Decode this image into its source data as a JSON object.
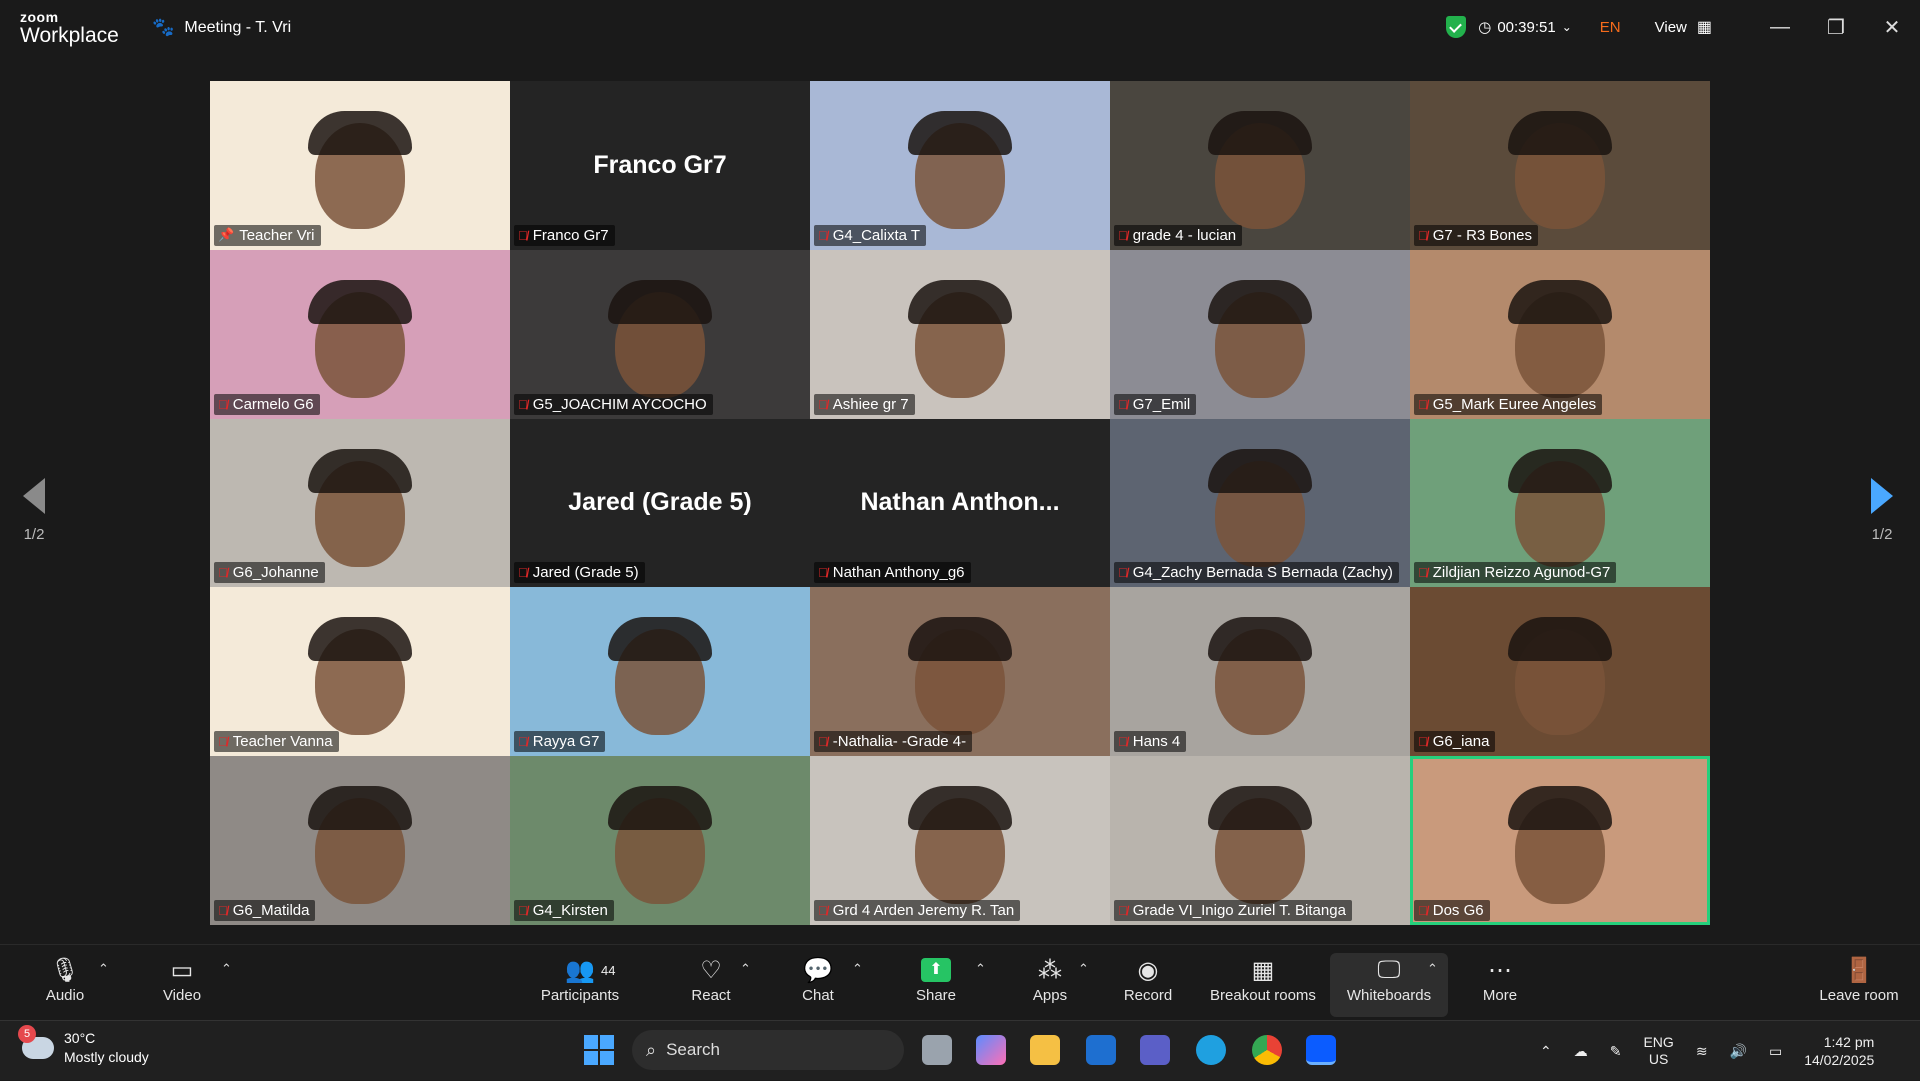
{
  "app": {
    "brand_top": "zoom",
    "brand_bottom": "Workplace",
    "meeting_title": "Meeting - T. Vri"
  },
  "titlebar": {
    "timer": "00:39:51",
    "language": "EN",
    "view_label": "View"
  },
  "pagination": {
    "left": "1/2",
    "right": "1/2"
  },
  "participants": [
    {
      "name": "Teacher Vri",
      "pinned": true,
      "big": "",
      "bg": "#f4ead9"
    },
    {
      "name": "Franco Gr7",
      "pinned": false,
      "big": "Franco Gr7",
      "bg": "#242424"
    },
    {
      "name": "G4_Calixta T",
      "pinned": false,
      "big": "",
      "bg": "#a9b8d6"
    },
    {
      "name": "grade 4 - lucian",
      "pinned": false,
      "big": "",
      "bg": "#4a463f"
    },
    {
      "name": "G7 - R3 Bones",
      "pinned": false,
      "big": "",
      "bg": "#5b4b3b"
    },
    {
      "name": "Carmelo G6",
      "pinned": false,
      "big": "",
      "bg": "#d69fb8"
    },
    {
      "name": "G5_JOACHIM AYCOCHO",
      "pinned": false,
      "big": "",
      "bg": "#3c3a3a"
    },
    {
      "name": "Ashiee gr 7",
      "pinned": false,
      "big": "",
      "bg": "#c9c3bd"
    },
    {
      "name": "G7_Emil",
      "pinned": false,
      "big": "",
      "bg": "#8c8c94"
    },
    {
      "name": "G5_Mark Euree Angeles",
      "pinned": false,
      "big": "",
      "bg": "#b48a6c"
    },
    {
      "name": "G6_Johanne",
      "pinned": false,
      "big": "",
      "bg": "#bdb8b1"
    },
    {
      "name": "Jared (Grade 5)",
      "pinned": false,
      "big": "Jared (Grade 5)",
      "bg": "#242424"
    },
    {
      "name": "Nathan Anthony_g6",
      "pinned": false,
      "big": "Nathan  Anthon...",
      "bg": "#242424"
    },
    {
      "name": "G4_Zachy Bernada S Bernada (Zachy)",
      "pinned": false,
      "big": "",
      "bg": "#5d6471"
    },
    {
      "name": "Zildjian Reizzo Agunod-G7",
      "pinned": false,
      "big": "",
      "bg": "#6fa07a"
    },
    {
      "name": "Teacher Vanna",
      "pinned": false,
      "big": "",
      "bg": "#f4ead9"
    },
    {
      "name": "Rayya G7",
      "pinned": false,
      "big": "",
      "bg": "#88b9d9"
    },
    {
      "name": "-Nathalia- -Grade 4-",
      "pinned": false,
      "big": "",
      "bg": "#8a6f5d"
    },
    {
      "name": "Hans 4",
      "pinned": false,
      "big": "",
      "bg": "#a8a49f"
    },
    {
      "name": "G6_iana",
      "pinned": false,
      "big": "",
      "bg": "#6b4b33"
    },
    {
      "name": "G6_Matilda",
      "pinned": false,
      "big": "",
      "bg": "#8f8a86"
    },
    {
      "name": "G4_Kirsten",
      "pinned": false,
      "big": "",
      "bg": "#6d8a6b"
    },
    {
      "name": "Grd 4 Arden Jeremy R. Tan",
      "pinned": false,
      "big": "",
      "bg": "#c8c3bd"
    },
    {
      "name": "Grade VI_Inigo Zuriel T. Bitanga",
      "pinned": false,
      "big": "",
      "bg": "#b9b4ad"
    },
    {
      "name": "Dos G6",
      "pinned": false,
      "big": "",
      "bg": "#c99a7c",
      "active": true
    }
  ],
  "toolbar": {
    "audio": "Audio",
    "video": "Video",
    "participants": "Participants",
    "participants_count": "44",
    "react": "React",
    "chat": "Chat",
    "share": "Share",
    "apps": "Apps",
    "record": "Record",
    "breakout": "Breakout rooms",
    "whiteboards": "Whiteboards",
    "more": "More",
    "leave": "Leave room"
  },
  "taskbar": {
    "temp": "30°C",
    "weather": "Mostly cloudy",
    "weather_badge": "5",
    "search": "Search",
    "lang1": "ENG",
    "lang2": "US",
    "time": "1:42 pm",
    "date": "14/02/2025"
  },
  "icons": [
    "paw-icon",
    "shield-check-icon",
    "clock-icon",
    "grid-view-icon",
    "minimize-icon",
    "restore-icon",
    "close-icon",
    "mic-icon",
    "camera-icon",
    "people-icon",
    "heart-icon",
    "chat-icon",
    "share-icon",
    "apps-icon",
    "record-icon",
    "breakout-icon",
    "whiteboard-icon",
    "more-icon",
    "leave-icon"
  ]
}
